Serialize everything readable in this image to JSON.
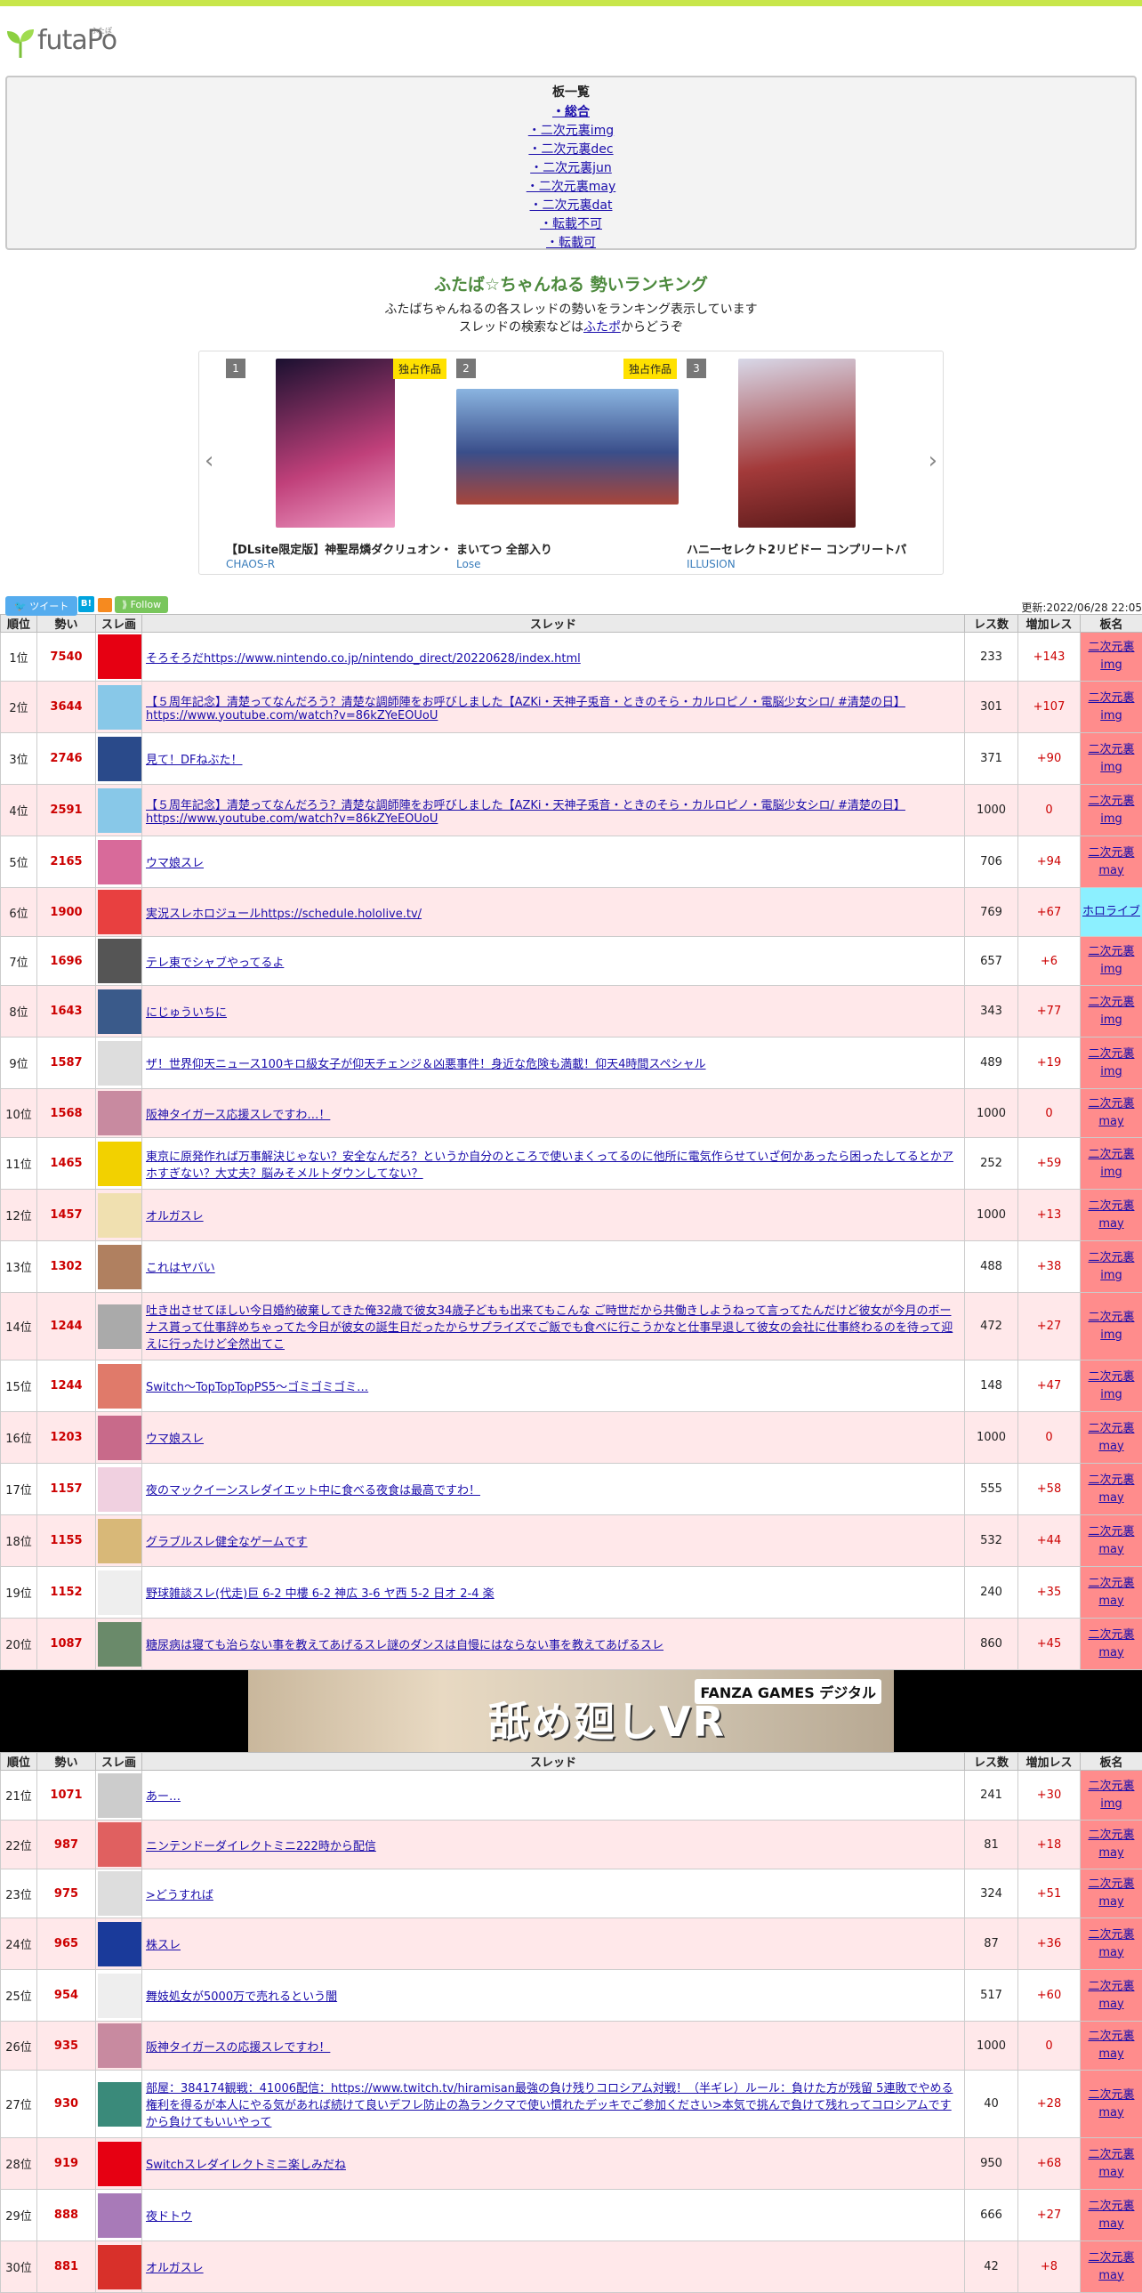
{
  "site": {
    "logo_text": "futaPo",
    "logo_ruby": "ふたぽ"
  },
  "boards": {
    "title": "板一覧",
    "items": [
      "・総合",
      "・二次元裏img",
      "・二次元裏dec",
      "・二次元裏jun",
      "・二次元裏may",
      "・二次元裏dat",
      "・転載不可",
      "・転載可"
    ]
  },
  "ranking": {
    "title": "ふたば☆ちゃんねる 勢いランキング",
    "desc1": "ふたばちゃんねるの各スレッドの勢いをランキング表示しています",
    "desc2_pre": "スレッドの検索などは",
    "desc2_link": "ふたポ",
    "desc2_post": "からどうぞ"
  },
  "carousel": {
    "prev": "‹",
    "next": "›",
    "slides": [
      {
        "num": "1",
        "tag": "独占作品",
        "title": "【DLsite限定版】神聖昂燐ダクリュオン・",
        "maker": "CHAOS-R",
        "color": "#c0407a"
      },
      {
        "num": "2",
        "tag": "独占作品",
        "title": "まいてつ 全部入り",
        "maker": "Lose",
        "color": "#3a4e8a"
      },
      {
        "num": "3",
        "tag": "",
        "title": "ハニーセレクト2リビドー コンプリートパ",
        "maker": "ILLUSION",
        "color": "#a33a3a"
      }
    ]
  },
  "shares": {
    "tweet": "ツイート",
    "hatena": "B!",
    "follow": "Follow",
    "updated": "更新:2022/06/28 22:05"
  },
  "table": {
    "headers": [
      "順位",
      "勢い",
      "スレ画",
      "スレッド",
      "レス数",
      "増加レス",
      "板名"
    ],
    "rows1": [
      {
        "rank": "1位",
        "power": "7540",
        "title": "そろそろだhttps://www.nintendo.co.jp/nintendo_direct/20220628/index.html",
        "res": "233",
        "inc": "+143",
        "board": "二次元裏img",
        "color": "#e60012"
      },
      {
        "rank": "2位",
        "power": "3644",
        "title": "【５周年記念】清楚ってなんだろう？清楚な調師陣をお呼びしました【AZKi・天神子兎音・ときのそら・カルロピノ・電脳少女シロ/ #清楚の日】https://www.youtube.com/watch?v=86kZYeEOUoU",
        "res": "301",
        "inc": "+107",
        "board": "二次元裏img",
        "color": "#88c8e8"
      },
      {
        "rank": "3位",
        "power": "2746",
        "title": "見て！DFねぶた！",
        "res": "371",
        "inc": "+90",
        "board": "二次元裏img",
        "color": "#2a4a8a"
      },
      {
        "rank": "4位",
        "power": "2591",
        "title": "【５周年記念】清楚ってなんだろう？清楚な調師陣をお呼びしました【AZKi・天神子兎音・ときのそら・カルロピノ・電脳少女シロ/ #清楚の日】https://www.youtube.com/watch?v=86kZYeEOUoU",
        "res": "1000",
        "inc": "0",
        "board": "二次元裏img",
        "color": "#88c8e8"
      },
      {
        "rank": "5位",
        "power": "2165",
        "title": "ウマ娘スレ",
        "res": "706",
        "inc": "+94",
        "board": "二次元裏may",
        "color": "#d86a9a"
      },
      {
        "rank": "6位",
        "power": "1900",
        "title": "実況スレホロジュールhttps://schedule.hololive.tv/",
        "res": "769",
        "inc": "+67",
        "board": "ホロライブ",
        "color": "#e84040",
        "holo": true
      },
      {
        "rank": "7位",
        "power": "1696",
        "title": "テレ東でシャブやってるよ",
        "res": "657",
        "inc": "+6",
        "board": "二次元裏img",
        "color": "#555555"
      },
      {
        "rank": "8位",
        "power": "1643",
        "title": "にじゅういちに",
        "res": "343",
        "inc": "+77",
        "board": "二次元裏img",
        "color": "#3a5a8a"
      },
      {
        "rank": "9位",
        "power": "1587",
        "title": "ザ！世界仰天ニュース100キロ級女子が仰天チェンジ＆凶悪事件！身近な危険も満載！仰天4時間スペシャル",
        "res": "489",
        "inc": "+19",
        "board": "二次元裏img",
        "color": "#dddddd"
      },
      {
        "rank": "10位",
        "power": "1568",
        "title": "阪神タイガース応援スレですわ…！",
        "res": "1000",
        "inc": "0",
        "board": "二次元裏may",
        "color": "#c88aa0"
      },
      {
        "rank": "11位",
        "power": "1465",
        "title": "東京に原発作れば万事解決じゃない？安全なんだろ？というか自分のところで使いまくってるのに他所に電気作らせていざ何かあったら困ったしてるとかアホすぎない？大丈夫？脳みそメルトダウンしてない？",
        "res": "252",
        "inc": "+59",
        "board": "二次元裏img",
        "color": "#f2d100"
      },
      {
        "rank": "12位",
        "power": "1457",
        "title": "オルガスレ",
        "res": "1000",
        "inc": "+13",
        "board": "二次元裏may",
        "color": "#f0e0b0"
      },
      {
        "rank": "13位",
        "power": "1302",
        "title": "これはヤバい",
        "res": "488",
        "inc": "+38",
        "board": "二次元裏img",
        "color": "#b08060"
      },
      {
        "rank": "14位",
        "power": "1244",
        "title": "吐き出させてほしい今日婚約破棄してきた俺32歳で彼女34歳子どもも出来てもこんな ご時世だから共働きしようねって言ってたんだけど彼女が今月のボーナス貰って仕事辞めちゃってた今日が彼女の誕生日だったからサプライズでご飯でも食べに行こうかなと仕事早退して彼女の会社に仕事終わるのを待って迎えに行ったけど全然出てこ",
        "res": "472",
        "inc": "+27",
        "board": "二次元裏img",
        "color": "#aaaaaa"
      },
      {
        "rank": "15位",
        "power": "1244",
        "title": "Switch〜TopTopTopPS5〜ゴミゴミゴミ…",
        "res": "148",
        "inc": "+47",
        "board": "二次元裏img",
        "color": "#e07a6a"
      },
      {
        "rank": "16位",
        "power": "1203",
        "title": "ウマ娘スレ",
        "res": "1000",
        "inc": "0",
        "board": "二次元裏may",
        "color": "#c86a8a"
      },
      {
        "rank": "17位",
        "power": "1157",
        "title": "夜のマックイーンスレダイエット中に食べる夜食は最高ですわ！",
        "res": "555",
        "inc": "+58",
        "board": "二次元裏may",
        "color": "#f0d0e0"
      },
      {
        "rank": "18位",
        "power": "1155",
        "title": "グラブルスレ健全なゲームです",
        "res": "532",
        "inc": "+44",
        "board": "二次元裏may",
        "color": "#d8b878"
      },
      {
        "rank": "19位",
        "power": "1152",
        "title": "野球雑談スレ(代走)巨 6-2 中樓 6-2 神広 3-6 ヤ西 5-2 日オ 2-4 楽",
        "res": "240",
        "inc": "+35",
        "board": "二次元裏may",
        "color": "#eeeeee"
      },
      {
        "rank": "20位",
        "power": "1087",
        "title": "糖尿病は寝ても治らない事を教えてあげるスレ謎のダンスは自慢にはならない事を教えてあげるスレ",
        "res": "860",
        "inc": "+45",
        "board": "二次元裏may",
        "color": "#6a8a6a"
      }
    ],
    "rows2": [
      {
        "rank": "21位",
        "power": "1071",
        "title": "あー…",
        "res": "241",
        "inc": "+30",
        "board": "二次元裏img",
        "color": "#cccccc"
      },
      {
        "rank": "22位",
        "power": "987",
        "title": "ニンテンドーダイレクトミニ222時から配信",
        "res": "81",
        "inc": "+18",
        "board": "二次元裏may",
        "color": "#e06060"
      },
      {
        "rank": "23位",
        "power": "975",
        "title": ">どうすれば",
        "res": "324",
        "inc": "+51",
        "board": "二次元裏may",
        "color": "#dddddd"
      },
      {
        "rank": "24位",
        "power": "965",
        "title": "株スレ",
        "res": "87",
        "inc": "+36",
        "board": "二次元裏may",
        "color": "#1a3a9a"
      },
      {
        "rank": "25位",
        "power": "954",
        "title": "舞妓処女が5000万で売れるという闇",
        "res": "517",
        "inc": "+60",
        "board": "二次元裏may",
        "color": "#eeeeee"
      },
      {
        "rank": "26位",
        "power": "935",
        "title": "阪神タイガースの応援スレですわ！",
        "res": "1000",
        "inc": "0",
        "board": "二次元裏may",
        "color": "#c88aa0"
      },
      {
        "rank": "27位",
        "power": "930",
        "title": "部屋：384174観戦：41006配信：https://www.twitch.tv/hiramisan最強の負け残りコロシアム対戦！（半ギレ）ルール：負けた方が残留 5連敗でやめる権利を得るが本人にやる気があれば続けて良いデフレ防止の為ランクマで使い慣れたデッキでご参加ください>本気で挑んで負けて残れってコロシアムですから負けてもいいやって",
        "res": "40",
        "inc": "+28",
        "board": "二次元裏may",
        "color": "#3a8a7a"
      },
      {
        "rank": "28位",
        "power": "919",
        "title": "Switchスレダイレクトミニ楽しみだね",
        "res": "950",
        "inc": "+68",
        "board": "二次元裏may",
        "color": "#e60012"
      },
      {
        "rank": "29位",
        "power": "888",
        "title": "夜ドトウ",
        "res": "666",
        "inc": "+27",
        "board": "二次元裏may",
        "color": "#a87ab8"
      },
      {
        "rank": "30位",
        "power": "881",
        "title": "オルガスレ",
        "res": "42",
        "inc": "+8",
        "board": "二次元裏may",
        "color": "#d8302a"
      }
    ]
  },
  "ad": {
    "text": "舐め廻しVR",
    "brand": "FANZA GAMES デジタル"
  }
}
